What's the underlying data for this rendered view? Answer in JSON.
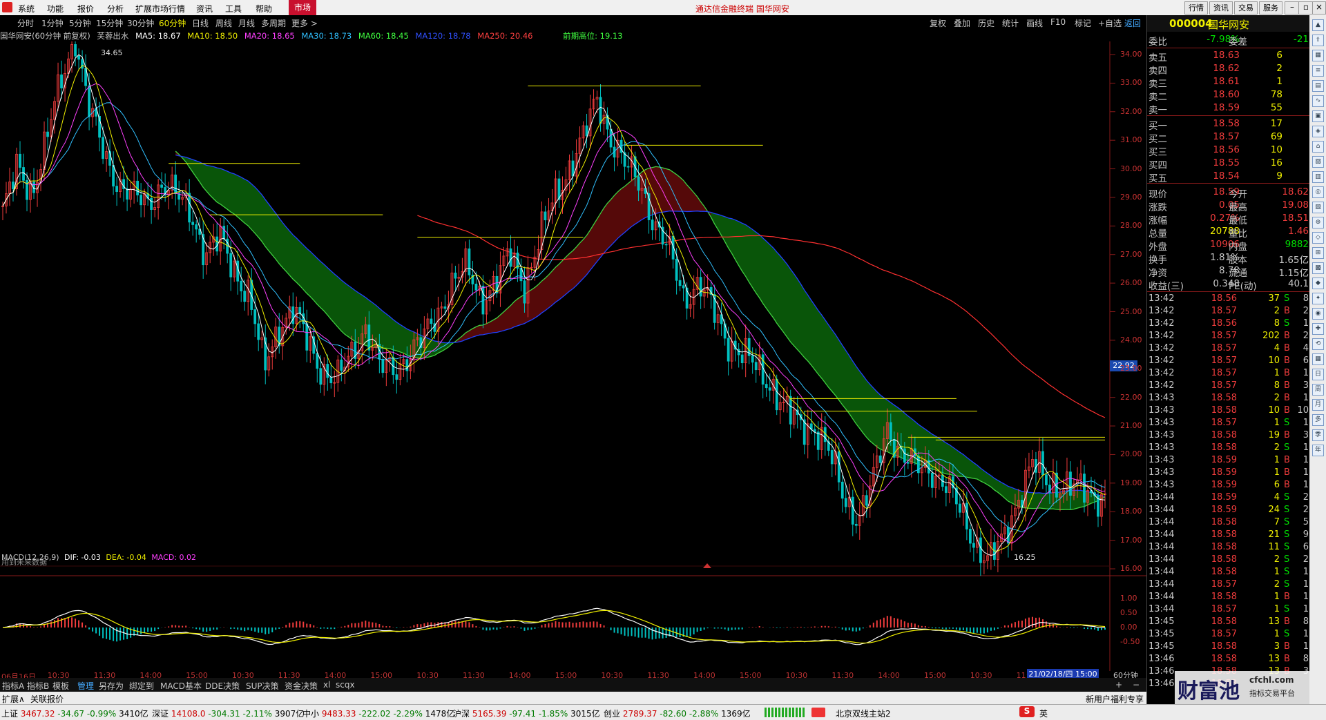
{
  "menu": {
    "items": [
      "系统",
      "功能",
      "报价",
      "分析",
      "扩展市场行情",
      "资讯",
      "工具",
      "帮助"
    ],
    "market_label": "市场",
    "center_title": "通达信金融终端  国华网安",
    "right_buttons": [
      "行情",
      "资讯",
      "交易",
      "服务"
    ]
  },
  "periods": {
    "items": [
      "分时",
      "1分钟",
      "5分钟",
      "15分钟",
      "30分钟",
      "60分钟",
      "日线",
      "周线",
      "月线",
      "多周期",
      "更多 >"
    ],
    "active": "60分钟",
    "right_tools": [
      "复权",
      "叠加",
      "历史",
      "统计",
      "画线",
      "F10",
      "标记",
      "+自选",
      "返回"
    ]
  },
  "chart_header": {
    "stock": "国华网安(60分钟 前复权)",
    "indicator": "芙蓉出水",
    "ma5": "MA5: 18.67",
    "ma10": "MA10: 18.50",
    "ma20": "MA20: 18.65",
    "ma30": "MA30: 18.73",
    "ma60": "MA60: 18.45",
    "ma120": "MA120: 18.78",
    "ma250": "MA250: 20.46",
    "prev_high": "前期高位: 19.13"
  },
  "chart_labels": {
    "high_label": "34.65",
    "low_label": "16.25",
    "current_price_tag": "22.92",
    "future_data": "用到未来数据",
    "macd_header": "MACD(12,26,9)",
    "macd_dif": "DIF: -0.03",
    "macd_dea": "DEA: -0.04",
    "macd_val": "MACD: 0.02",
    "cursor_time": "21/02/18/四 15:00",
    "period_tag": "60分钟"
  },
  "chart_data": {
    "type": "line",
    "price_axis": [
      "34.00",
      "33.00",
      "32.00",
      "31.00",
      "30.00",
      "29.00",
      "28.00",
      "27.00",
      "26.00",
      "25.00",
      "24.00",
      "23.00",
      "22.00",
      "21.00",
      "20.00",
      "19.00",
      "18.00",
      "17.00",
      "16.00"
    ],
    "macd_axis": [
      "1.00",
      "0.50",
      "0.00",
      "-0.50"
    ],
    "time_axis": [
      "06月16日",
      "10:30",
      "11:30",
      "14:00",
      "15:00",
      "10:30",
      "11:30",
      "14:00",
      "15:00",
      "10:30",
      "11:30",
      "14:00",
      "15:00",
      "10:30",
      "11:30",
      "14:00",
      "15:00",
      "10:30",
      "11:30",
      "14:00",
      "15:00",
      "10:30",
      "11:30",
      "15"
    ],
    "close_approx": [
      28.5,
      30.0,
      29.2,
      31.0,
      33.0,
      34.65,
      32.0,
      30.5,
      29.5,
      29.0,
      28.8,
      29.5,
      29.0,
      28.5,
      27.0,
      27.5,
      26.5,
      25.5,
      23.0,
      24.5,
      25.0,
      24.0,
      23.0,
      22.5,
      23.5,
      24.5,
      23.0,
      23.0,
      23.5,
      24.0,
      25.0,
      26.0,
      26.5,
      25.5,
      26.0,
      27.0,
      26.0,
      27.5,
      29.0,
      30.0,
      31.0,
      32.5,
      31.0,
      30.0,
      29.5,
      28.0,
      27.0,
      25.5,
      26.0,
      25.0,
      24.0,
      23.5,
      23.0,
      22.5,
      21.5,
      21.0,
      21.0,
      20.0,
      18.5,
      17.8,
      19.0,
      21.0,
      20.0,
      19.5,
      19.5,
      19.0,
      18.0,
      17.0,
      16.25,
      17.0,
      18.5,
      19.7,
      19.0,
      19.0,
      18.8,
      18.6,
      18.59
    ]
  },
  "quote": {
    "code": "000004",
    "name": "国华网安",
    "weibi_label": "委比",
    "weibi": "-7.98%",
    "weicha_label": "委差",
    "weicha": "-21",
    "asks": [
      {
        "label": "卖五",
        "price": "18.63",
        "vol": "6"
      },
      {
        "label": "卖四",
        "price": "18.62",
        "vol": "2"
      },
      {
        "label": "卖三",
        "price": "18.61",
        "vol": "1"
      },
      {
        "label": "卖二",
        "price": "18.60",
        "vol": "78"
      },
      {
        "label": "卖一",
        "price": "18.59",
        "vol": "55"
      }
    ],
    "bids": [
      {
        "label": "买一",
        "price": "18.58",
        "vol": "17"
      },
      {
        "label": "买二",
        "price": "18.57",
        "vol": "69"
      },
      {
        "label": "买三",
        "price": "18.56",
        "vol": "10"
      },
      {
        "label": "买四",
        "price": "18.55",
        "vol": "16"
      },
      {
        "label": "买五",
        "price": "18.54",
        "vol": "9"
      }
    ],
    "stats": [
      {
        "l1": "现价",
        "v1": "18.59",
        "l2": "今开",
        "v2": "18.62"
      },
      {
        "l1": "涨跌",
        "v1": "0.05",
        "l2": "最高",
        "v2": "19.08"
      },
      {
        "l1": "涨幅",
        "v1": "0.27%",
        "l2": "最低",
        "v2": "18.51"
      },
      {
        "l1": "总量",
        "v1": "20788",
        "l2": "量比",
        "v2": "1.46"
      },
      {
        "l1": "外盘",
        "v1": "10906",
        "l2": "内盘",
        "v2": "9882"
      },
      {
        "l1": "换手",
        "v1": "1.81%",
        "l2": "股本",
        "v2": "1.65亿"
      },
      {
        "l1": "净资",
        "v1": "8.78",
        "l2": "流通",
        "v2": "1.15亿"
      },
      {
        "l1": "收益(三)",
        "v1": "0.348",
        "l2": "PE(动)",
        "v2": "40.1"
      }
    ],
    "ticks": [
      {
        "t": "13:42",
        "p": "18.56",
        "v": "37",
        "bs": "S",
        "n": "8"
      },
      {
        "t": "13:42",
        "p": "18.57",
        "v": "2",
        "bs": "B",
        "n": "2"
      },
      {
        "t": "13:42",
        "p": "18.56",
        "v": "8",
        "bs": "S",
        "n": "1"
      },
      {
        "t": "13:42",
        "p": "18.57",
        "v": "202",
        "bs": "B",
        "n": "2"
      },
      {
        "t": "13:42",
        "p": "18.57",
        "v": "4",
        "bs": "B",
        "n": "4"
      },
      {
        "t": "13:42",
        "p": "18.57",
        "v": "10",
        "bs": "B",
        "n": "6"
      },
      {
        "t": "13:42",
        "p": "18.57",
        "v": "1",
        "bs": "B",
        "n": "1"
      },
      {
        "t": "13:42",
        "p": "18.57",
        "v": "8",
        "bs": "B",
        "n": "3"
      },
      {
        "t": "13:43",
        "p": "18.58",
        "v": "2",
        "bs": "B",
        "n": "1"
      },
      {
        "t": "13:43",
        "p": "18.58",
        "v": "10",
        "bs": "B",
        "n": "10"
      },
      {
        "t": "13:43",
        "p": "18.57",
        "v": "1",
        "bs": "S",
        "n": "1"
      },
      {
        "t": "13:43",
        "p": "18.58",
        "v": "19",
        "bs": "B",
        "n": "3"
      },
      {
        "t": "13:43",
        "p": "18.58",
        "v": "2",
        "bs": "S",
        "n": "1"
      },
      {
        "t": "13:43",
        "p": "18.59",
        "v": "1",
        "bs": "B",
        "n": "1"
      },
      {
        "t": "13:43",
        "p": "18.59",
        "v": "1",
        "bs": "B",
        "n": "1"
      },
      {
        "t": "13:43",
        "p": "18.59",
        "v": "6",
        "bs": "B",
        "n": "1"
      },
      {
        "t": "13:44",
        "p": "18.59",
        "v": "4",
        "bs": "S",
        "n": "2"
      },
      {
        "t": "13:44",
        "p": "18.59",
        "v": "24",
        "bs": "S",
        "n": "2"
      },
      {
        "t": "13:44",
        "p": "18.58",
        "v": "7",
        "bs": "S",
        "n": "5"
      },
      {
        "t": "13:44",
        "p": "18.58",
        "v": "21",
        "bs": "S",
        "n": "9"
      },
      {
        "t": "13:44",
        "p": "18.58",
        "v": "11",
        "bs": "S",
        "n": "6"
      },
      {
        "t": "13:44",
        "p": "18.58",
        "v": "2",
        "bs": "S",
        "n": "2"
      },
      {
        "t": "13:44",
        "p": "18.58",
        "v": "1",
        "bs": "S",
        "n": "1"
      },
      {
        "t": "13:44",
        "p": "18.57",
        "v": "2",
        "bs": "S",
        "n": "1"
      },
      {
        "t": "13:44",
        "p": "18.58",
        "v": "1",
        "bs": "B",
        "n": "1"
      },
      {
        "t": "13:44",
        "p": "18.57",
        "v": "1",
        "bs": "S",
        "n": "1"
      },
      {
        "t": "13:45",
        "p": "18.58",
        "v": "13",
        "bs": "B",
        "n": "8"
      },
      {
        "t": "13:45",
        "p": "18.57",
        "v": "1",
        "bs": "S",
        "n": "1"
      },
      {
        "t": "13:45",
        "p": "18.58",
        "v": "3",
        "bs": "B",
        "n": "1"
      },
      {
        "t": "13:46",
        "p": "18.58",
        "v": "13",
        "bs": "B",
        "n": "8"
      },
      {
        "t": "13:46",
        "p": "18.58",
        "v": "13",
        "bs": "B",
        "n": "3"
      },
      {
        "t": "13:46",
        "p": "18.58",
        "v": "",
        "bs": "",
        "n": ""
      }
    ]
  },
  "bottom_tabs": {
    "items": [
      "指标A",
      "指标B",
      "模板",
      "管理",
      "另存为",
      "绑定到",
      "MACD基本",
      "DDE决策",
      "SUP决策",
      "资金决策",
      "xl",
      "scqx"
    ],
    "active": "管理"
  },
  "info_bar": {
    "left1": "扩展∧",
    "left2": "关联报价",
    "notice": "新用户福利专享",
    "watermark": "财富池",
    "watermark_site": "cfchl.com",
    "watermark_sub": "指标交易平台"
  },
  "status": {
    "items": [
      {
        "name": "上证",
        "val": "3467.32",
        "chg": "-34.67",
        "pct": "-0.99%",
        "amt": "3410亿"
      },
      {
        "name": "深证",
        "val": "14108.0",
        "chg": "-304.31",
        "pct": "-2.11%",
        "amt": "3907亿"
      },
      {
        "name": "中小",
        "val": "9483.33",
        "chg": "-222.02",
        "pct": "-2.29%",
        "amt": "1478亿"
      },
      {
        "name": "沪深",
        "val": "5165.39",
        "chg": "-97.41",
        "pct": "-1.85%",
        "amt": "3015亿"
      },
      {
        "name": "创业",
        "val": "2789.37",
        "chg": "-82.60",
        "pct": "-2.88%",
        "amt": "1369亿"
      }
    ],
    "server": "北京双线主站2",
    "ime": "英"
  },
  "colors": {
    "up": "#f03c3c",
    "down": "#00c0c0",
    "ma5": "#ffffff",
    "ma10": "#f0f000",
    "ma20": "#ff40ff",
    "ma30": "#30c0ff",
    "ma60": "#40ff40",
    "ma250": "#ff4040",
    "green_band": "#0a5a0a",
    "red_band": "#5a0a0a"
  }
}
